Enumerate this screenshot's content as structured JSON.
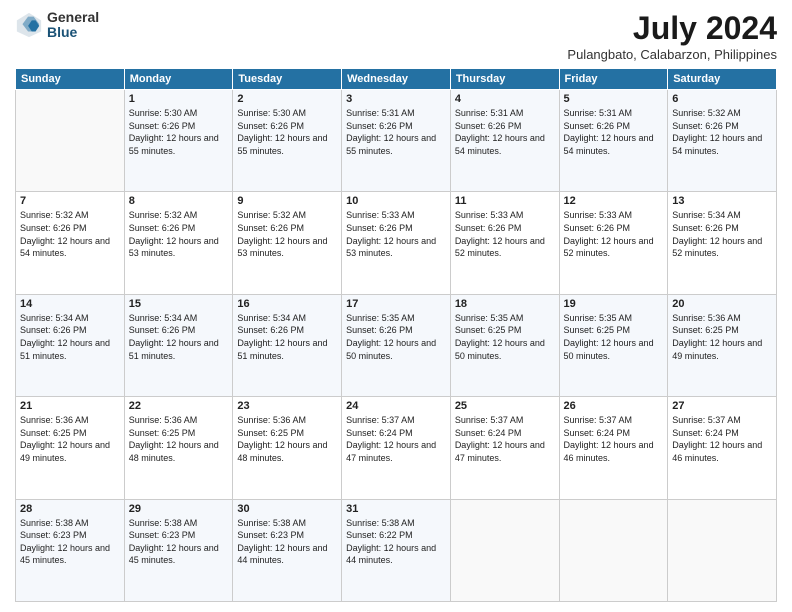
{
  "header": {
    "logo": {
      "general": "General",
      "blue": "Blue"
    },
    "title": "July 2024",
    "subtitle": "Pulangbato, Calabarzon, Philippines"
  },
  "weekdays": [
    "Sunday",
    "Monday",
    "Tuesday",
    "Wednesday",
    "Thursday",
    "Friday",
    "Saturday"
  ],
  "weeks": [
    [
      {
        "day": "",
        "info": ""
      },
      {
        "day": "1",
        "info": "Sunrise: 5:30 AM\nSunset: 6:26 PM\nDaylight: 12 hours\nand 55 minutes."
      },
      {
        "day": "2",
        "info": "Sunrise: 5:30 AM\nSunset: 6:26 PM\nDaylight: 12 hours\nand 55 minutes."
      },
      {
        "day": "3",
        "info": "Sunrise: 5:31 AM\nSunset: 6:26 PM\nDaylight: 12 hours\nand 55 minutes."
      },
      {
        "day": "4",
        "info": "Sunrise: 5:31 AM\nSunset: 6:26 PM\nDaylight: 12 hours\nand 54 minutes."
      },
      {
        "day": "5",
        "info": "Sunrise: 5:31 AM\nSunset: 6:26 PM\nDaylight: 12 hours\nand 54 minutes."
      },
      {
        "day": "6",
        "info": "Sunrise: 5:32 AM\nSunset: 6:26 PM\nDaylight: 12 hours\nand 54 minutes."
      }
    ],
    [
      {
        "day": "7",
        "info": ""
      },
      {
        "day": "8",
        "info": "Sunrise: 5:32 AM\nSunset: 6:26 PM\nDaylight: 12 hours\nand 53 minutes."
      },
      {
        "day": "9",
        "info": "Sunrise: 5:32 AM\nSunset: 6:26 PM\nDaylight: 12 hours\nand 53 minutes."
      },
      {
        "day": "10",
        "info": "Sunrise: 5:33 AM\nSunset: 6:26 PM\nDaylight: 12 hours\nand 53 minutes."
      },
      {
        "day": "11",
        "info": "Sunrise: 5:33 AM\nSunset: 6:26 PM\nDaylight: 12 hours\nand 52 minutes."
      },
      {
        "day": "12",
        "info": "Sunrise: 5:33 AM\nSunset: 6:26 PM\nDaylight: 12 hours\nand 52 minutes."
      },
      {
        "day": "13",
        "info": "Sunrise: 5:34 AM\nSunset: 6:26 PM\nDaylight: 12 hours\nand 52 minutes."
      }
    ],
    [
      {
        "day": "14",
        "info": ""
      },
      {
        "day": "15",
        "info": "Sunrise: 5:34 AM\nSunset: 6:26 PM\nDaylight: 12 hours\nand 51 minutes."
      },
      {
        "day": "16",
        "info": "Sunrise: 5:34 AM\nSunset: 6:26 PM\nDaylight: 12 hours\nand 51 minutes."
      },
      {
        "day": "17",
        "info": "Sunrise: 5:35 AM\nSunset: 6:26 PM\nDaylight: 12 hours\nand 50 minutes."
      },
      {
        "day": "18",
        "info": "Sunrise: 5:35 AM\nSunset: 6:25 PM\nDaylight: 12 hours\nand 50 minutes."
      },
      {
        "day": "19",
        "info": "Sunrise: 5:35 AM\nSunset: 6:25 PM\nDaylight: 12 hours\nand 50 minutes."
      },
      {
        "day": "20",
        "info": "Sunrise: 5:36 AM\nSunset: 6:25 PM\nDaylight: 12 hours\nand 49 minutes."
      }
    ],
    [
      {
        "day": "21",
        "info": ""
      },
      {
        "day": "22",
        "info": "Sunrise: 5:36 AM\nSunset: 6:25 PM\nDaylight: 12 hours\nand 48 minutes."
      },
      {
        "day": "23",
        "info": "Sunrise: 5:36 AM\nSunset: 6:25 PM\nDaylight: 12 hours\nand 48 minutes."
      },
      {
        "day": "24",
        "info": "Sunrise: 5:37 AM\nSunset: 6:24 PM\nDaylight: 12 hours\nand 47 minutes."
      },
      {
        "day": "25",
        "info": "Sunrise: 5:37 AM\nSunset: 6:24 PM\nDaylight: 12 hours\nand 47 minutes."
      },
      {
        "day": "26",
        "info": "Sunrise: 5:37 AM\nSunset: 6:24 PM\nDaylight: 12 hours\nand 46 minutes."
      },
      {
        "day": "27",
        "info": "Sunrise: 5:37 AM\nSunset: 6:24 PM\nDaylight: 12 hours\nand 46 minutes."
      }
    ],
    [
      {
        "day": "28",
        "info": "Sunrise: 5:38 AM\nSunset: 6:23 PM\nDaylight: 12 hours\nand 45 minutes."
      },
      {
        "day": "29",
        "info": "Sunrise: 5:38 AM\nSunset: 6:23 PM\nDaylight: 12 hours\nand 45 minutes."
      },
      {
        "day": "30",
        "info": "Sunrise: 5:38 AM\nSunset: 6:23 PM\nDaylight: 12 hours\nand 44 minutes."
      },
      {
        "day": "31",
        "info": "Sunrise: 5:38 AM\nSunset: 6:22 PM\nDaylight: 12 hours\nand 44 minutes."
      },
      {
        "day": "",
        "info": ""
      },
      {
        "day": "",
        "info": ""
      },
      {
        "day": "",
        "info": ""
      }
    ]
  ],
  "week1_day7_info": "Sunrise: 5:32 AM\nSunset: 6:26 PM\nDaylight: 12 hours\nand 54 minutes.",
  "week2_day14_info": "Sunrise: 5:34 AM\nSunset: 6:26 PM\nDaylight: 12 hours\nand 51 minutes.",
  "week3_day21_info": "Sunrise: 5:36 AM\nSunset: 6:25 PM\nDaylight: 12 hours\nand 49 minutes."
}
